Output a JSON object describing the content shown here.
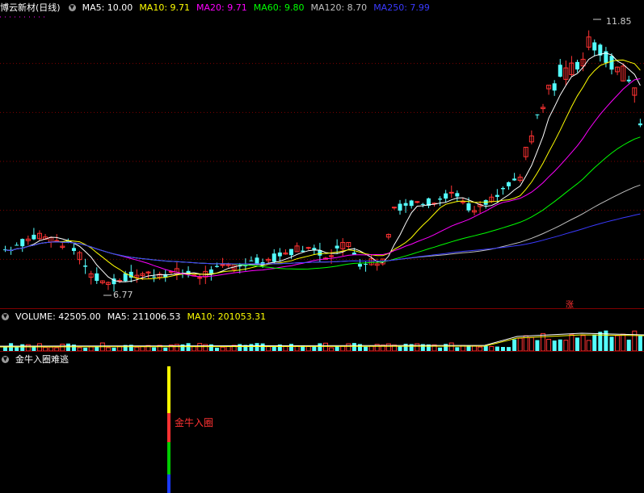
{
  "header": {
    "title": "博云新材(日线)",
    "ma": [
      {
        "label": "MA5: 10.00",
        "color": "#ffffff"
      },
      {
        "label": "MA10: 9.71",
        "color": "#ffff00"
      },
      {
        "label": "MA20: 9.71",
        "color": "#ff00ff"
      },
      {
        "label": "MA60: 9.80",
        "color": "#00ff00"
      },
      {
        "label": "MA120: 8.70",
        "color": "#c0c0c0"
      },
      {
        "label": "MA250: 7.99",
        "color": "#3a3aff"
      }
    ]
  },
  "price_panel": {
    "high_label": "11.85",
    "low_label": "6.77",
    "zhang_badge": "涨"
  },
  "volume_panel": {
    "volume_label": "VOLUME: 42505.00",
    "ma5_label": "MA5: 211006.53",
    "ma10_label": "MA10: 201053.31"
  },
  "indicator_panel": {
    "title": "金牛入圈难逃",
    "signal_label": "金牛入圈"
  },
  "colors": {
    "up": "#ff3232",
    "down": "#54ffff",
    "grid": "#800000"
  },
  "chart_data": {
    "type": "candlestick",
    "y_range": [
      6.4,
      12.2
    ],
    "high": 11.85,
    "low": 6.77,
    "last_ma": {
      "MA5": 10.0,
      "MA10": 9.71,
      "MA20": 9.71,
      "MA60": 9.8,
      "MA120": 8.7,
      "MA250": 7.99
    }
  }
}
